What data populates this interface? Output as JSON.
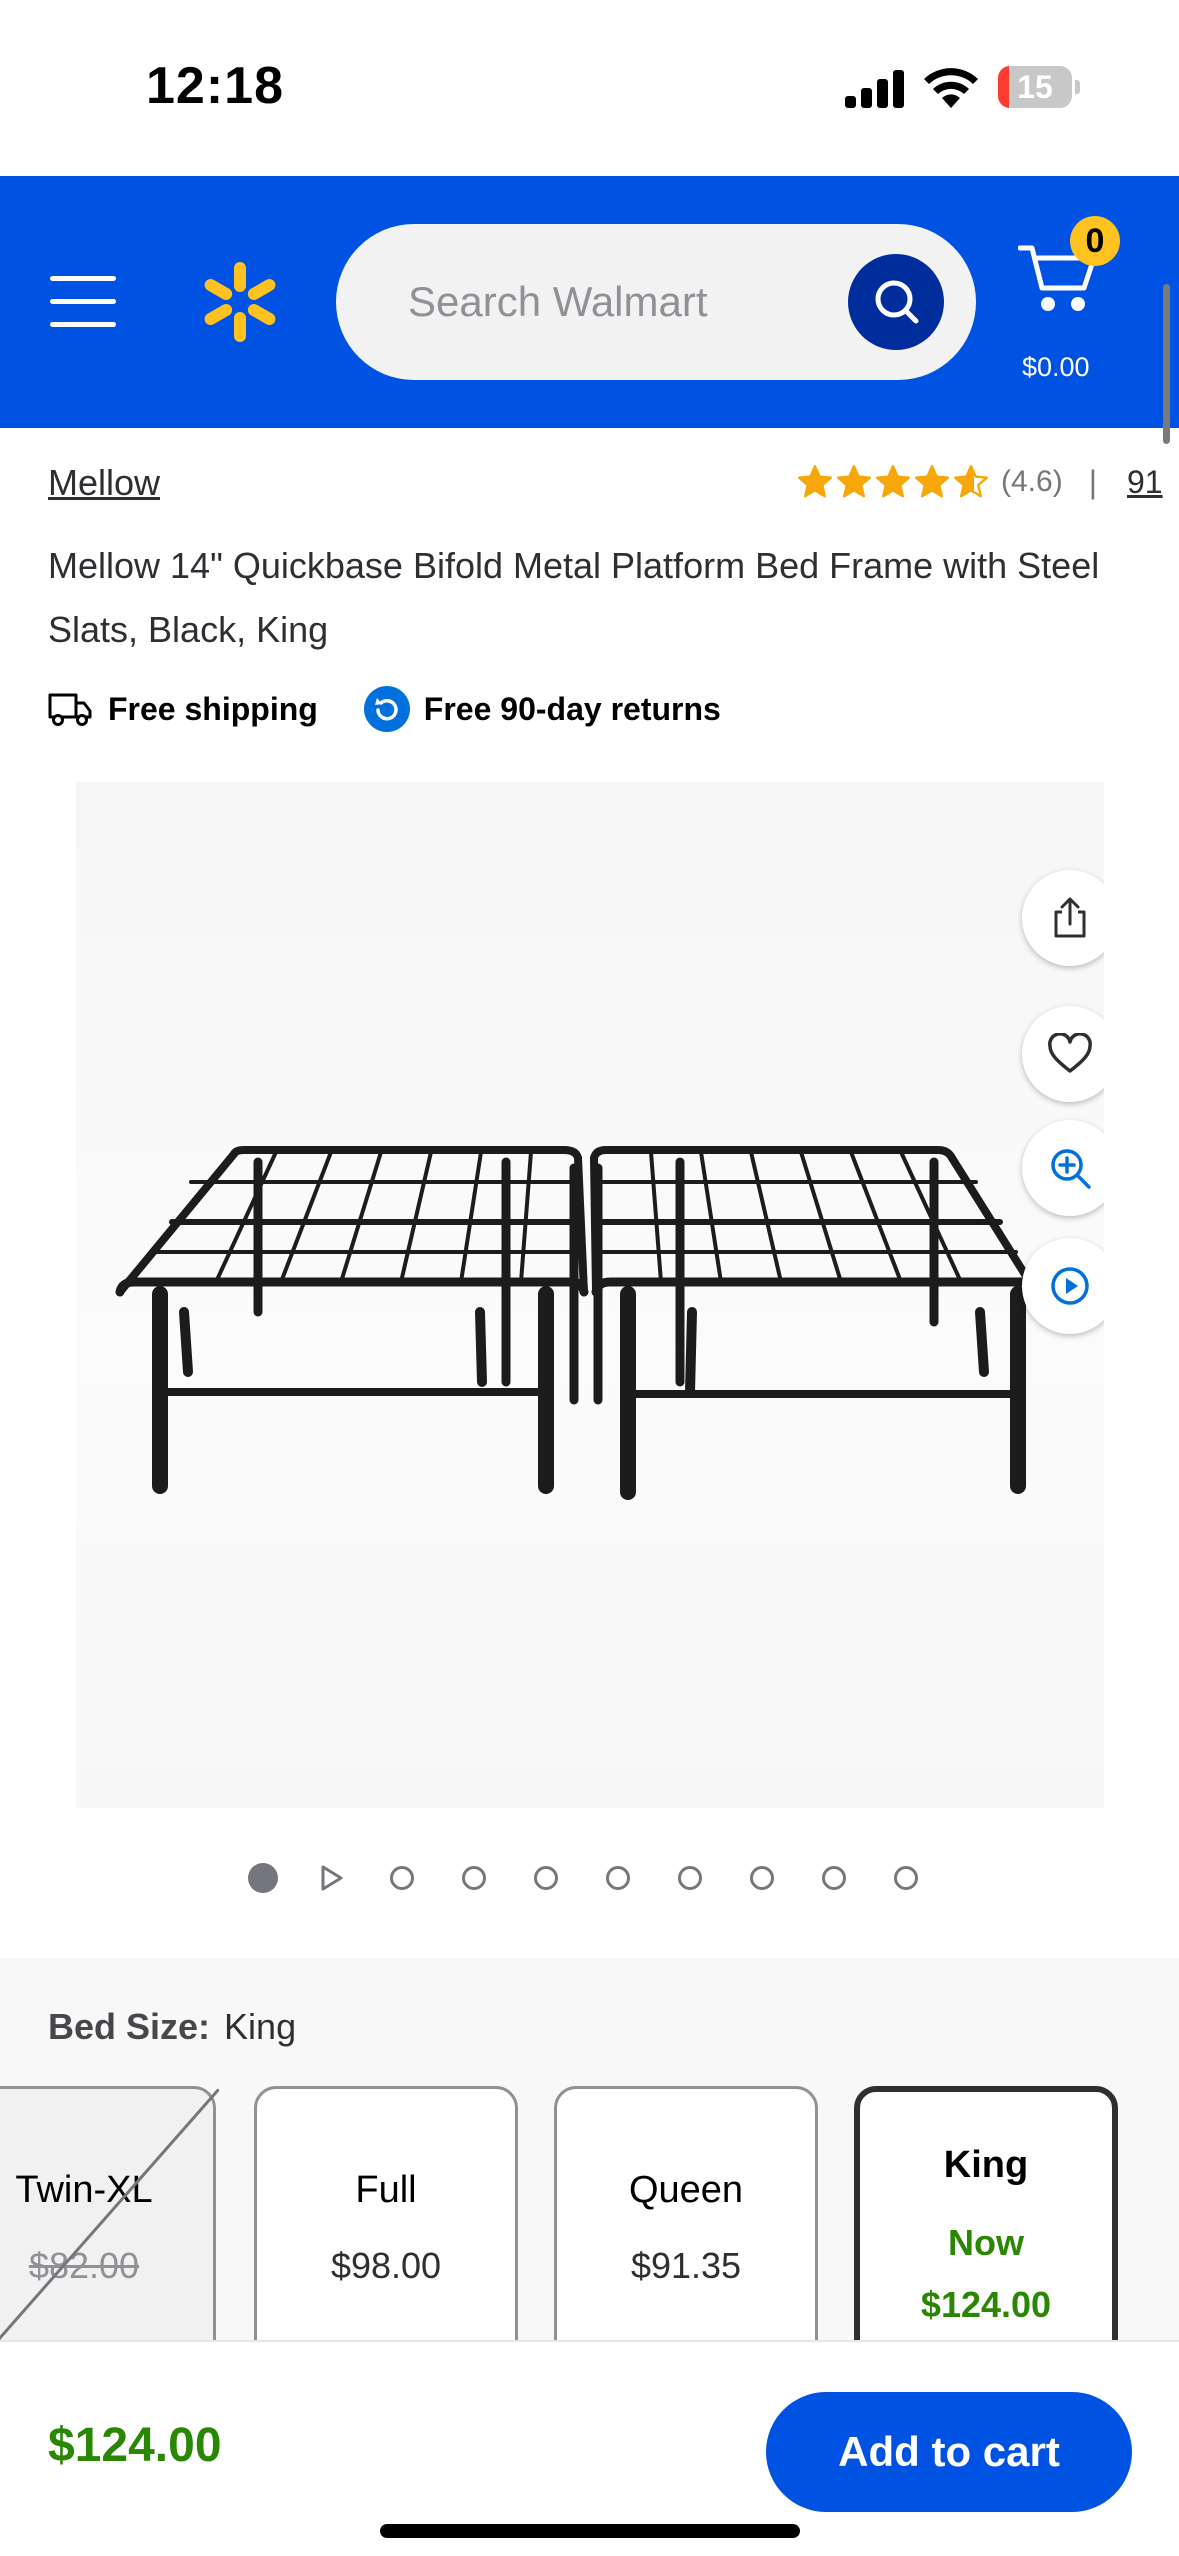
{
  "status_bar": {
    "time": "12:18",
    "battery_level": "15",
    "battery_fraction": 0.15,
    "battery_color": "#ff3b30"
  },
  "header": {
    "search_placeholder": "Search Walmart",
    "cart_count": "0",
    "cart_total": "$0.00",
    "brand_color": "#0053e2",
    "spark_color": "#ffc220"
  },
  "product": {
    "brand": "Mellow",
    "rating": 4.6,
    "rating_text": "(4.6)",
    "rating_separator": "|",
    "review_count": "91",
    "title": "Mellow 14\" Quickbase Bifold Metal Platform Bed Frame with Steel Slats, Black, King",
    "badges": {
      "shipping": "Free shipping",
      "returns": "Free 90-day returns"
    }
  },
  "gallery": {
    "image_count": 10,
    "active_index": 0,
    "video_index": 1
  },
  "variants": {
    "label": "Bed Size:",
    "selected": "King",
    "options": [
      {
        "name": "Twin-XL",
        "price": "$82.00",
        "available": false
      },
      {
        "name": "Full",
        "price": "$98.00",
        "available": true
      },
      {
        "name": "Queen",
        "price": "$91.35",
        "available": true
      },
      {
        "name": "King",
        "now_label": "Now",
        "price": "$124.00",
        "available": true,
        "selected": true
      }
    ]
  },
  "bottom_bar": {
    "price": "$124.00",
    "add_to_cart": "Add to cart"
  },
  "colors": {
    "sale_green": "#2a8703",
    "accent_blue": "#0071dc"
  }
}
